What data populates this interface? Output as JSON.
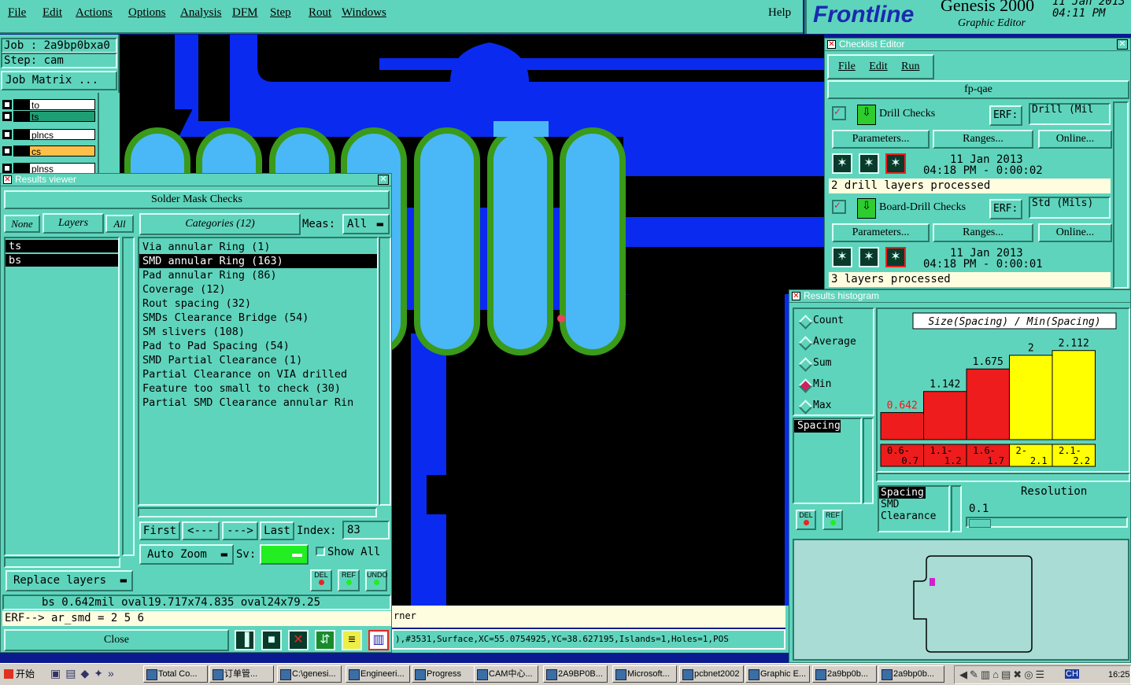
{
  "menubar": [
    "File",
    "Edit",
    "Actions",
    "Options",
    "Analysis",
    "DFM",
    "Step",
    "Rout",
    "Windows"
  ],
  "help": "Help",
  "brand": {
    "logo": "Frontline",
    "product": "Genesis 2000",
    "subtitle": "Graphic Editor",
    "date": "11 Jan 2013",
    "time": "04:11 PM"
  },
  "job": {
    "job_label": "Job : 2a9bp0bxa0",
    "step_label": "Step: cam",
    "matrix_button": "Job Matrix ..."
  },
  "layers": [
    {
      "name": "to",
      "color": "#ffffff"
    },
    {
      "name": "ts",
      "color": "#1f9e74"
    },
    {
      "name": "plncs",
      "color": "#ffffff"
    },
    {
      "name": "cs",
      "color": "#ffc04a"
    },
    {
      "name": "plnss",
      "color": "#ffffff"
    }
  ],
  "results_viewer": {
    "title": "Results viewer",
    "header": "Solder Mask Checks",
    "tab_none": "None",
    "tab_layers": "Layers",
    "tab_all": "All",
    "categories_button": "Categories (12)",
    "meas_label": "Meas:",
    "meas_value": "All",
    "layer_list": [
      "ts",
      "bs"
    ],
    "categories": [
      "Via annular Ring (1)",
      "SMD annular Ring (163)",
      "Pad annular Ring (86)",
      "Coverage (12)",
      "Rout spacing (32)",
      "SMDs Clearance Bridge (54)",
      "SM slivers (108)",
      "Pad to Pad Spacing (54)",
      "SMD Partial Clearance (1)",
      "Partial Clearance on VIA drilled",
      "Feature too small to check (30)",
      "Partial SMD Clearance annular Rin"
    ],
    "selected_index": 1,
    "nav": {
      "first": "First",
      "prev": "<---",
      "next": "--->",
      "last": "Last",
      "index_label": "Index:",
      "index_value": "83"
    },
    "auto_zoom": "Auto Zoom",
    "sv_label": "Sv:",
    "show_all": "Show All",
    "replace_layers": "Replace layers",
    "del": "DEL",
    "ref": "REF",
    "undo": "UNDO",
    "status_line": "bs  0.642mil    oval19.717x74.835    oval24x79.25",
    "erf_line": "ERF--> ar_smd = 2 5 6",
    "close": "Close"
  },
  "coord_bar": {
    "partial": "rner",
    "feature": "),#3531,Surface,XC=55.0754925,YC=38.627195,Islands=1,Holes=1,POS"
  },
  "checklist": {
    "title": "Checklist Editor",
    "menu": [
      "File",
      "Edit",
      "Run"
    ],
    "name": "fp-qae",
    "checks": [
      {
        "name": "Drill Checks",
        "erf_label": "ERF:",
        "erf_value": "Drill (Mil",
        "params": "Parameters...",
        "ranges": "Ranges...",
        "online": "Online...",
        "date": "11 Jan 2013",
        "time": "04:18 PM - 0:00:02",
        "status": "2 drill layers processed"
      },
      {
        "name": "Board-Drill Checks",
        "erf_label": "ERF:",
        "erf_value": "Std (Mils)",
        "params": "Parameters...",
        "ranges": "Ranges...",
        "online": "Online...",
        "date": "11 Jan 2013",
        "time": "04:18 PM - 0:00:01",
        "status": "3 layers processed"
      }
    ]
  },
  "histogram": {
    "title": "Results histogram",
    "modes": [
      "Count",
      "Average",
      "Sum",
      "Min",
      "Max"
    ],
    "selected_mode": "Min",
    "spacing_list": [
      "Spacing"
    ],
    "chart_title": "Size(Spacing) / Min(Spacing)",
    "del": "DEL",
    "ref": "REF",
    "legend_list": [
      "Spacing",
      "SMD",
      "Clearance"
    ],
    "resolution_label": "Resolution",
    "resolution_value": "0.1"
  },
  "chart_data": {
    "type": "bar",
    "title": "Size(Spacing) / Min(Spacing)",
    "categories": [
      "0.6-0.7",
      "1.1-1.2",
      "1.6-1.7",
      "2-2.1",
      "2.1-2.2"
    ],
    "category_labels": [
      [
        "0.6-",
        "0.7"
      ],
      [
        "1.1-",
        "1.2"
      ],
      [
        "1.6-",
        "1.7"
      ],
      [
        "2-",
        "2.1"
      ],
      [
        "2.1-",
        "2.2"
      ]
    ],
    "values": [
      0.642,
      1.142,
      1.675,
      2,
      2.112
    ],
    "value_labels": [
      "0.642",
      "1.142",
      "1.675",
      "2",
      "2.112"
    ],
    "colors": [
      "#ee1c1c",
      "#ee1c1c",
      "#ee1c1c",
      "#ffff00",
      "#ffff00"
    ],
    "ylim": [
      0,
      2.2
    ]
  },
  "taskbar": {
    "start": "开始",
    "items": [
      "Total Co...",
      "订单管...",
      "C:\\genesi...",
      "Engineeri...",
      "Progress",
      "CAM中心...",
      "2A9BP0B...",
      "Microsoft...",
      "pcbnet2002",
      "Graphic E...",
      "2a9bp0b...",
      "2a9bp0b..."
    ],
    "clock": "16:25",
    "ch": "CH"
  },
  "colors": {
    "panel": "#5fd4bc",
    "canvas_bg": "#0b1a8f",
    "copper": "#0a2af0",
    "pad": "#4ab8f6",
    "mask": "#3a9a1a"
  }
}
